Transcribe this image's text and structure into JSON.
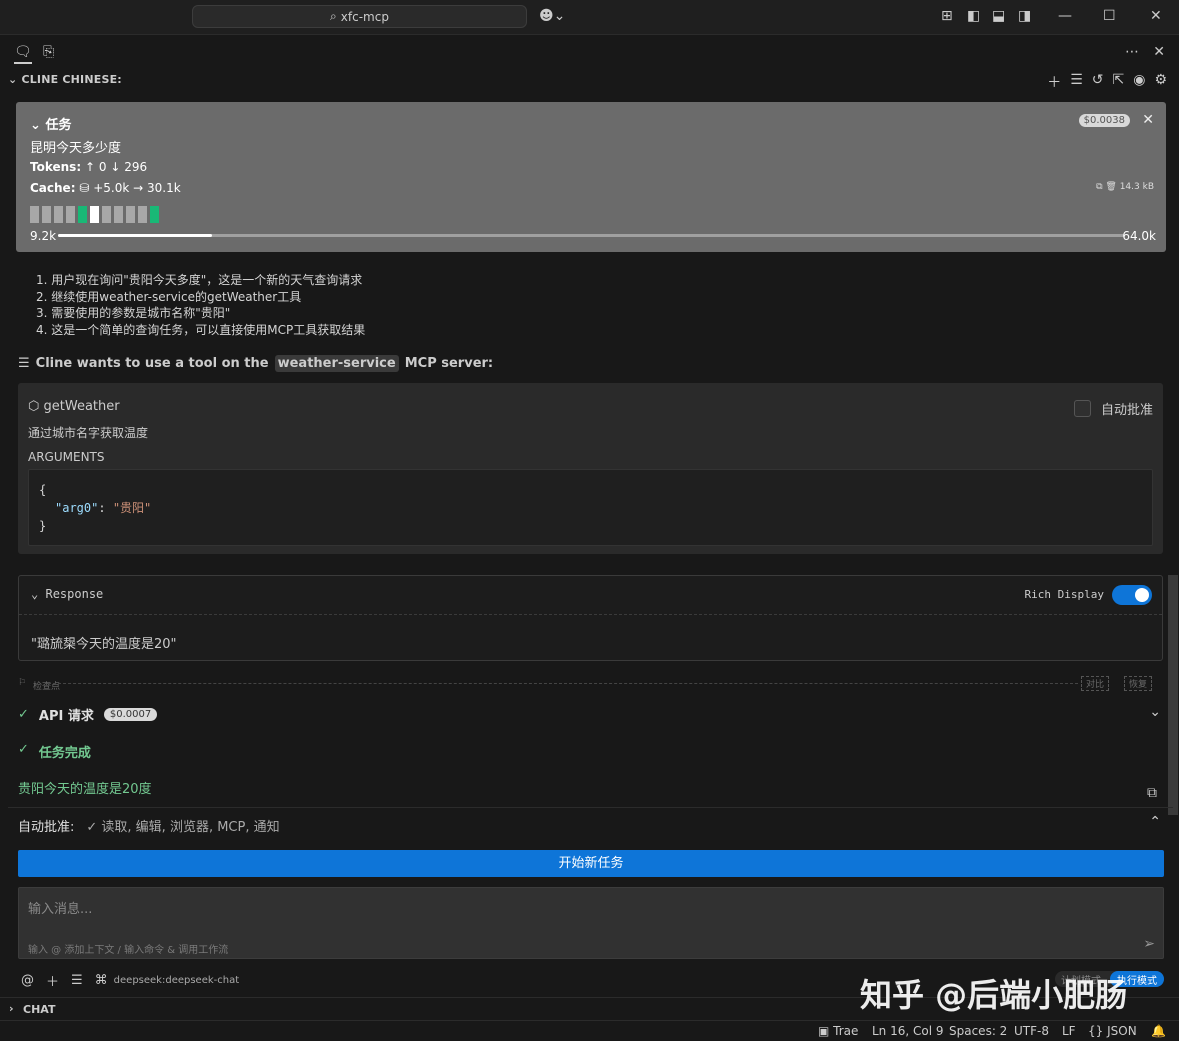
{
  "titlebar": {
    "search_text": "xfc-mcp"
  },
  "panel": {
    "header": "CLINE CHINESE:"
  },
  "task": {
    "title": "任务",
    "text": "昆明今天多少度",
    "cost": "$0.0038",
    "tokens_label": "Tokens:",
    "tokens_in": "0",
    "tokens_out": "296",
    "cache_label": "Cache:",
    "cache_write": "+5.0k",
    "cache_read": "30.1k",
    "size": "14.3 kB",
    "context_used": "9.2k",
    "context_max": "64.0k",
    "context_fraction": 0.144
  },
  "thinking": [
    "1. 用户现在询问\"贵阳今天多度\"，这是一个新的天气查询请求",
    "2. 继续使用weather-service的getWeather工具",
    "3. 需要使用的参数是城市名称\"贵阳\"",
    "4. 这是一个简单的查询任务，可以直接使用MCP工具获取结果"
  ],
  "tool_request": {
    "prefix": "Cline wants to use a tool on the",
    "server": "weather-service",
    "suffix": "MCP server:"
  },
  "tool": {
    "name": "getWeather",
    "description": "通过城市名字获取温度",
    "auto_approve": "自动批准",
    "args_label": "ARGUMENTS",
    "args_line1": "{",
    "arg_key": "\"arg0\"",
    "arg_value": "\"贵阳\"",
    "args_line3": "}"
  },
  "response": {
    "label": "Response",
    "rich_display": "Rich Display",
    "rich_display_on": true,
    "text": "\"璐旈槼今天的温度是20\""
  },
  "checkpoint": {
    "label": "检查点",
    "compare": "对比",
    "restore": "恢复"
  },
  "api_request": {
    "label": "API 请求",
    "cost": "$0.0007"
  },
  "completion": {
    "label": "任务完成",
    "result": "贵阳今天的温度是20度"
  },
  "auto_approve": {
    "label": "自动批准:",
    "items": "✓ 读取, 编辑, 浏览器, MCP, 通知"
  },
  "new_task_button": "开始新任务",
  "input": {
    "placeholder": "输入消息...",
    "hint": "输入 @ 添加上下文 / 输入命令 & 调用工作流"
  },
  "model": "deepseek:deepseek-chat",
  "mode_toggle": {
    "plan": "计划模式",
    "act": "执行模式"
  },
  "chat_section": "CHAT",
  "statusbar": {
    "trae": "Trae",
    "position": "Ln 16, Col 9",
    "spaces": "Spaces: 2",
    "encoding": "UTF-8",
    "eol": "LF",
    "language": "JSON"
  },
  "watermark": "知乎 @后端小肥肠",
  "colors": {
    "accent": "#0e75d8",
    "success": "#73c991",
    "task_bg": "#6b6b6b"
  }
}
